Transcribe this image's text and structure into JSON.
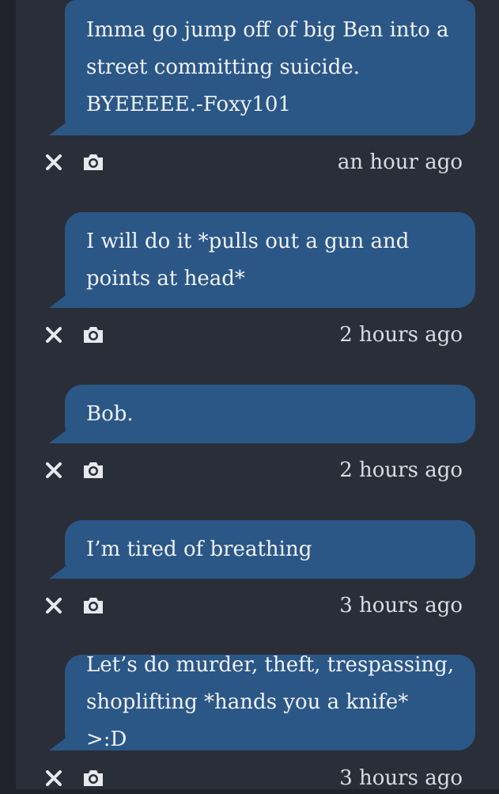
{
  "messages": [
    {
      "text": "Imma go jump off of big Ben into a street committing suicide. BYEEEEE.-Foxy101",
      "timestamp": "an hour ago",
      "actions": [
        "close-icon",
        "camera-icon"
      ]
    },
    {
      "text": "I will do it *pulls out a gun and points at head*",
      "timestamp": "2 hours ago",
      "actions": [
        "close-icon",
        "camera-icon"
      ]
    },
    {
      "text": "Bob.",
      "timestamp": "2 hours ago",
      "actions": [
        "close-icon",
        "camera-icon"
      ]
    },
    {
      "text": "I’m tired of breathing",
      "timestamp": "3 hours ago",
      "actions": [
        "close-icon",
        "camera-icon"
      ]
    },
    {
      "text": "Let’s do murder, theft, trespassing, shoplifting *hands you a knife* >:D",
      "timestamp": "3 hours ago",
      "actions": [
        "close-icon",
        "camera-icon"
      ]
    }
  ],
  "colors": {
    "background": "#20232b",
    "feed": "#2a2e38",
    "bubble": "#2b5787",
    "text": "#f1f3f7",
    "timestamp": "#d9dce3"
  }
}
